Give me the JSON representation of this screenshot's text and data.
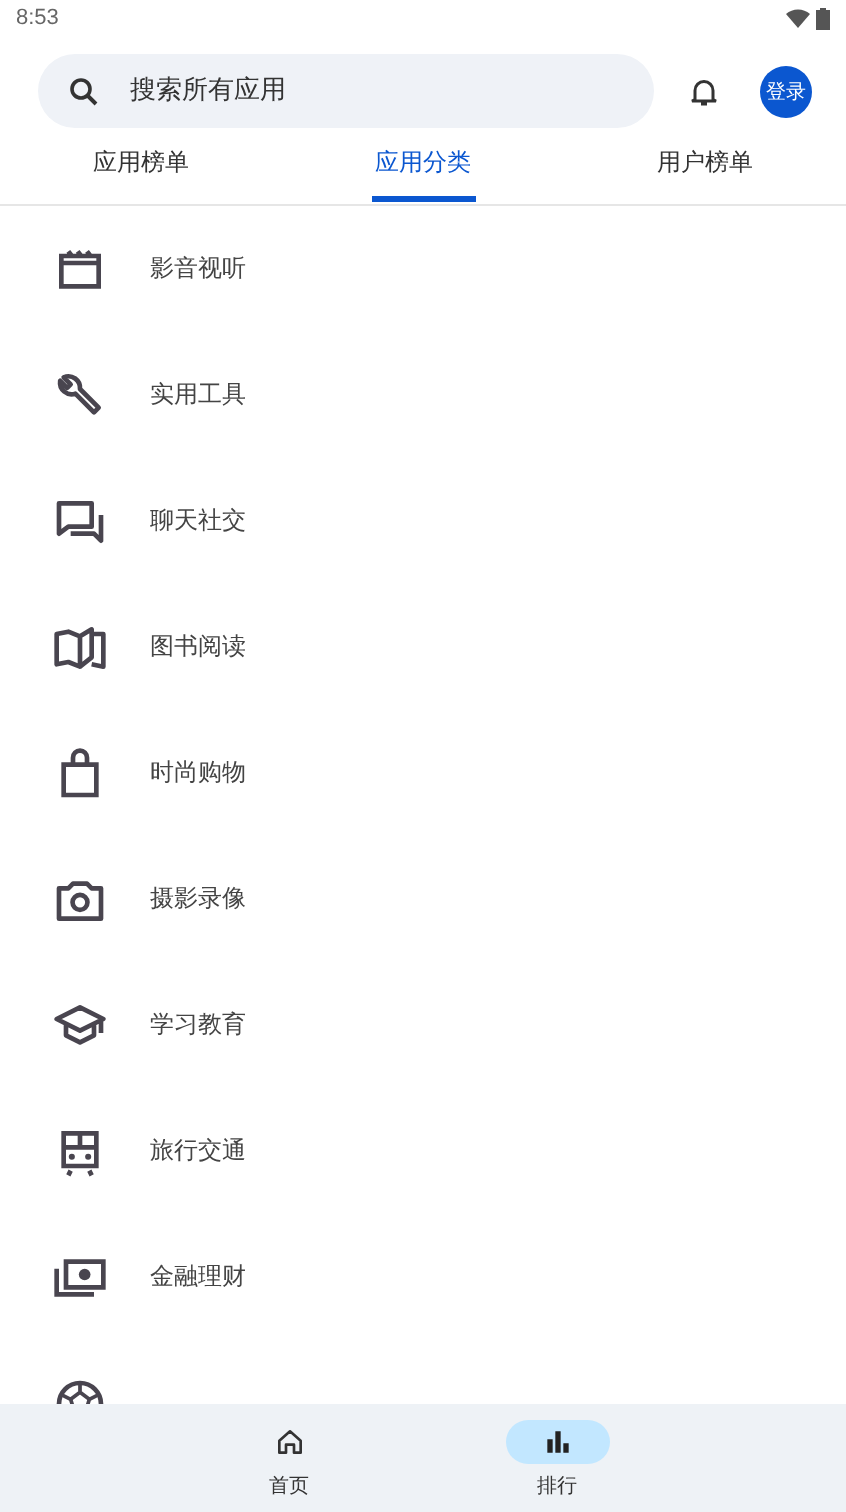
{
  "status_bar": {
    "time": "8:53"
  },
  "search": {
    "placeholder": "搜索所有应用"
  },
  "login_button": "登录",
  "tabs": [
    {
      "label": "应用榜单",
      "selected": false
    },
    {
      "label": "应用分类",
      "selected": true
    },
    {
      "label": "用户榜单",
      "selected": false
    }
  ],
  "categories": [
    {
      "kind": "film",
      "label": "影音视听"
    },
    {
      "kind": "wrench",
      "label": "实用工具"
    },
    {
      "kind": "chat",
      "label": "聊天社交"
    },
    {
      "kind": "book",
      "label": "图书阅读"
    },
    {
      "kind": "bag",
      "label": "时尚购物"
    },
    {
      "kind": "camera",
      "label": "摄影录像"
    },
    {
      "kind": "school",
      "label": "学习教育"
    },
    {
      "kind": "train",
      "label": "旅行交通"
    },
    {
      "kind": "money",
      "label": "金融理财"
    },
    {
      "kind": "ball"
    }
  ],
  "bottom_nav": [
    {
      "kind": "home",
      "label": "首页",
      "selected": false
    },
    {
      "kind": "rank",
      "label": "排行",
      "selected": true
    }
  ]
}
